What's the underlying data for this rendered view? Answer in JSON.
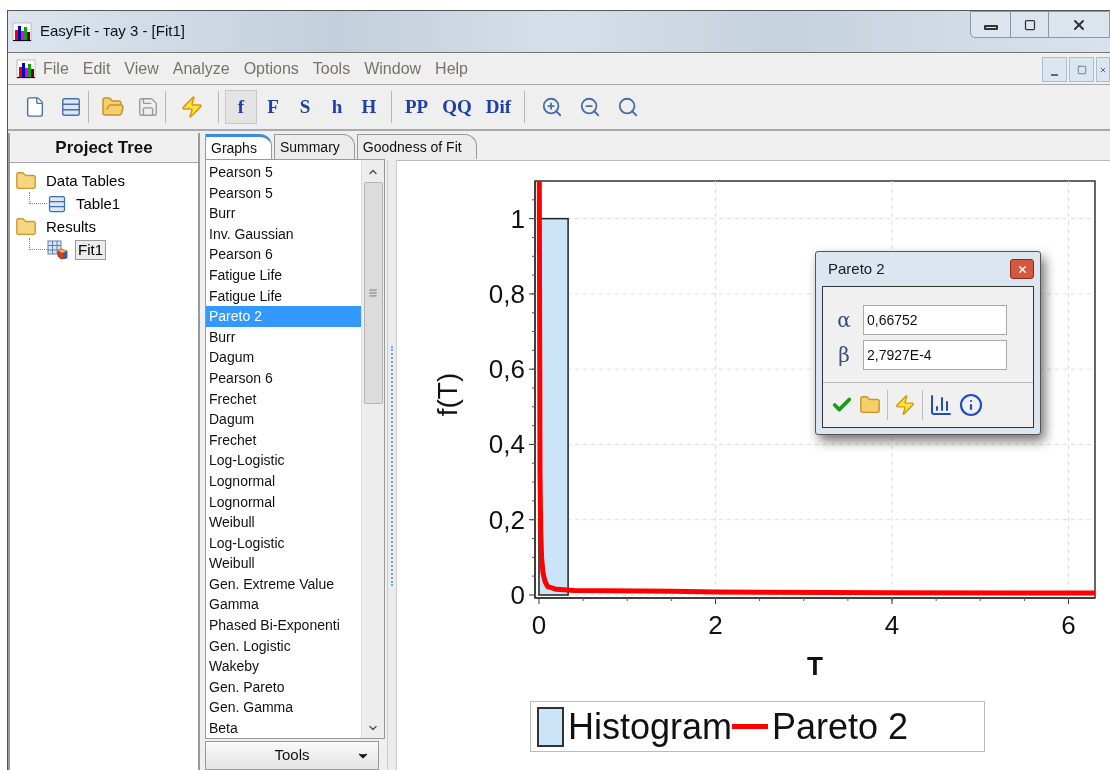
{
  "window": {
    "title": "EasyFit - тау 3 - [Fit1]"
  },
  "menu": [
    "File",
    "Edit",
    "View",
    "Analyze",
    "Options",
    "Tools",
    "Window",
    "Help"
  ],
  "toolbar": {
    "plot_buttons": [
      {
        "label": "f",
        "selected": true
      },
      {
        "label": "F",
        "selected": false
      },
      {
        "label": "S",
        "selected": false
      },
      {
        "label": "h",
        "selected": false
      },
      {
        "label": "H",
        "selected": false
      },
      {
        "label": "PP",
        "selected": false
      },
      {
        "label": "QQ",
        "selected": false
      },
      {
        "label": "Dif",
        "selected": false
      }
    ]
  },
  "project_tree": {
    "title": "Project Tree",
    "items": [
      {
        "label": "Data Tables",
        "kind": "folder",
        "selected": false,
        "children": [
          {
            "label": "Table1",
            "kind": "table",
            "selected": false
          }
        ]
      },
      {
        "label": "Results",
        "kind": "folder",
        "selected": false,
        "children": [
          {
            "label": "Fit1",
            "kind": "fit",
            "selected": true
          }
        ]
      }
    ]
  },
  "tabs": [
    {
      "label": "Graphs",
      "selected": true
    },
    {
      "label": "Summary",
      "selected": false
    },
    {
      "label": "Goodness of Fit",
      "selected": false
    }
  ],
  "distributions": [
    {
      "label": "Pearson 5",
      "selected": false
    },
    {
      "label": "Pearson 5",
      "selected": false
    },
    {
      "label": "Burr",
      "selected": false
    },
    {
      "label": "Inv. Gaussian",
      "selected": false
    },
    {
      "label": "Pearson 6",
      "selected": false
    },
    {
      "label": "Fatigue Life",
      "selected": false
    },
    {
      "label": "Fatigue Life",
      "selected": false
    },
    {
      "label": "Pareto 2",
      "selected": true
    },
    {
      "label": "Burr",
      "selected": false
    },
    {
      "label": "Dagum",
      "selected": false
    },
    {
      "label": "Pearson 6",
      "selected": false
    },
    {
      "label": "Frechet",
      "selected": false
    },
    {
      "label": "Dagum",
      "selected": false
    },
    {
      "label": "Frechet",
      "selected": false
    },
    {
      "label": "Log-Logistic",
      "selected": false
    },
    {
      "label": "Lognormal",
      "selected": false
    },
    {
      "label": "Lognormal",
      "selected": false
    },
    {
      "label": "Weibull",
      "selected": false
    },
    {
      "label": "Log-Logistic",
      "selected": false
    },
    {
      "label": "Weibull",
      "selected": false
    },
    {
      "label": "Gen. Extreme Value",
      "selected": false
    },
    {
      "label": "Gamma",
      "selected": false
    },
    {
      "label": "Phased Bi-Exponenti",
      "selected": false
    },
    {
      "label": "Gen. Logistic",
      "selected": false
    },
    {
      "label": "Wakeby",
      "selected": false
    },
    {
      "label": "Gen. Pareto",
      "selected": false
    },
    {
      "label": "Gen. Gamma",
      "selected": false
    },
    {
      "label": "Beta",
      "selected": false
    }
  ],
  "tools_button": "Tools",
  "chart": {
    "chart_data": {
      "type": "line",
      "xlabel": "T",
      "ylabel": "f(T)",
      "xlim": [
        -0.045,
        6.3
      ],
      "ylim": [
        -0.008,
        1.1
      ],
      "xticks": [
        0,
        2,
        4,
        6
      ],
      "yticks": [
        0,
        {
          "value": 0.2,
          "label": "0,2"
        },
        {
          "value": 0.4,
          "label": "0,4"
        },
        {
          "value": 0.6,
          "label": "0,6"
        },
        {
          "value": 0.8,
          "label": "0,8"
        },
        1
      ],
      "x": [
        0.004,
        0.012,
        0.02,
        0.03,
        0.045,
        0.07,
        0.1,
        0.2,
        0.4,
        1.5,
        2,
        4,
        6.3
      ],
      "grid": true,
      "series": [
        {
          "name": "Histogram",
          "type": "bar",
          "color": "#cce4f7",
          "x": [
            0.165
          ],
          "values": [
            1
          ]
        },
        {
          "name": "Pareto 2",
          "color": "#ff0000",
          "values": [
            1.1,
            0.32,
            0.17,
            0.1,
            0.06,
            0.035,
            0.022,
            0.015,
            0.012,
            0.01,
            0.008,
            0.006,
            0.005
          ]
        }
      ]
    }
  },
  "dialog": {
    "title": "Pareto 2",
    "params": [
      {
        "symbol": "α",
        "value": "0,66752"
      },
      {
        "symbol": "β",
        "value": "2,7927E-4"
      }
    ]
  }
}
